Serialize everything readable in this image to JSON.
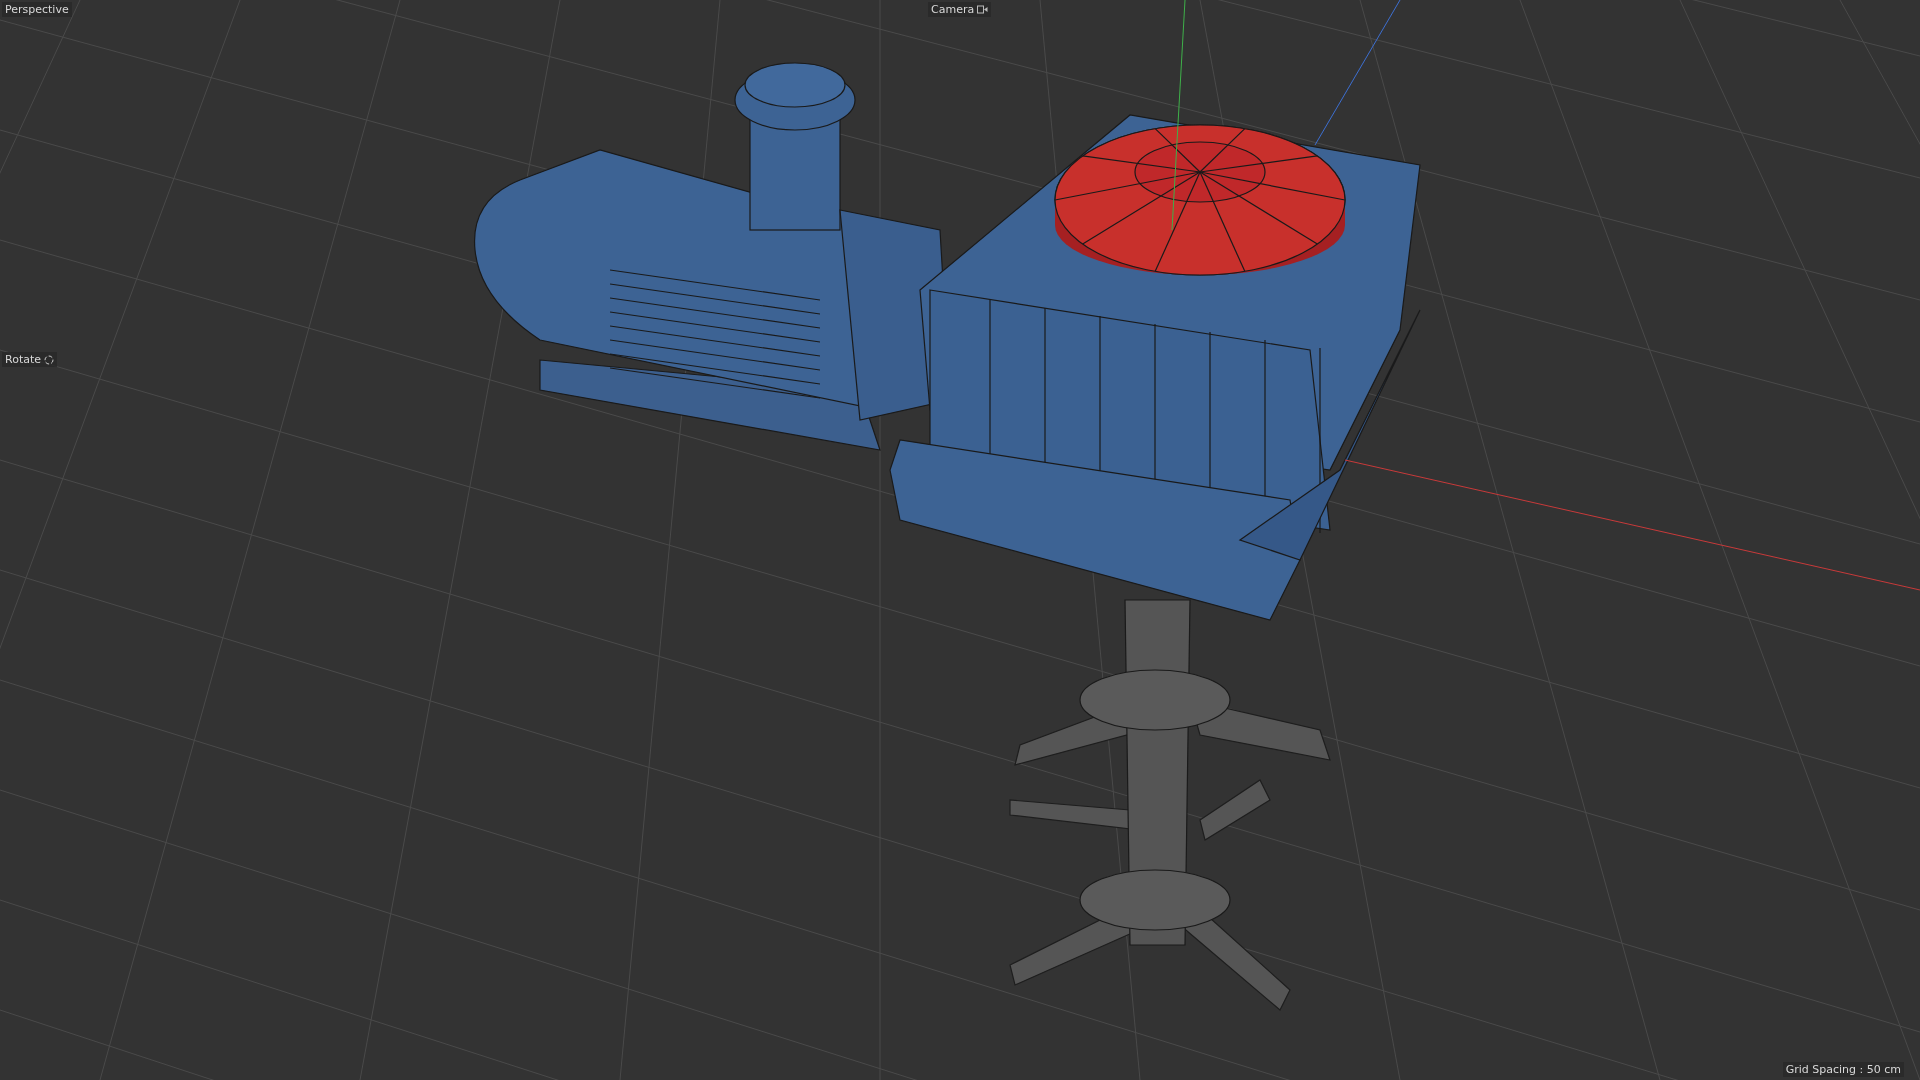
{
  "viewport": {
    "view_name": "Perspective",
    "camera_label": "Camera",
    "mode_label": "Rotate",
    "grid_spacing": "Grid Spacing : 50 cm"
  }
}
